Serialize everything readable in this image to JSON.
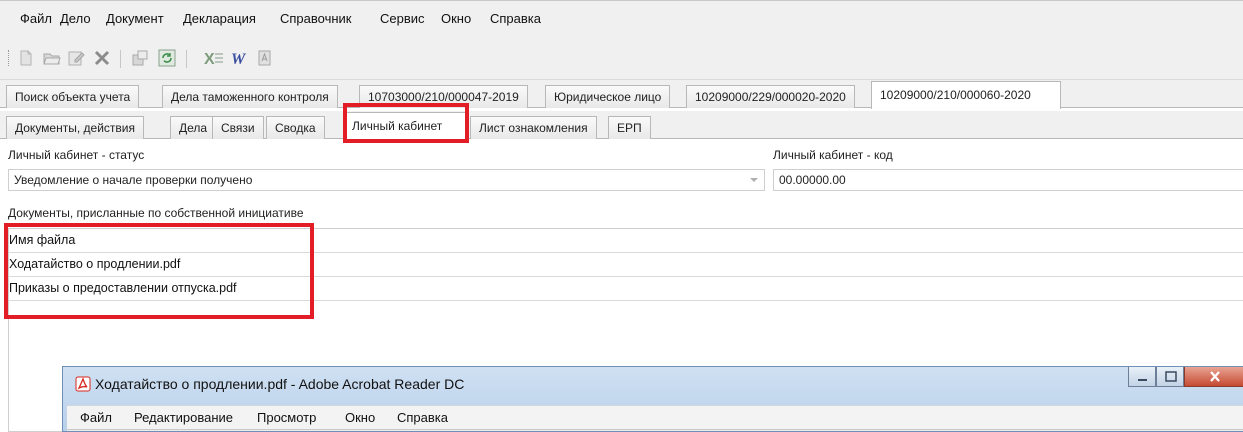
{
  "menu": [
    "Файл",
    "Дело",
    "Документ",
    "Декларация",
    "Справочник",
    "Сервис",
    "Окно",
    "Справка"
  ],
  "tabs_top": [
    "Поиск объекта учета",
    "Дела таможенного контроля",
    "10703000/210/000047-2019",
    "Юридическое лицо",
    "10209000/229/000020-2020",
    "10209000/210/000060-2020"
  ],
  "tabs_sub": [
    "Документы, действия",
    "Дела",
    "Связи",
    "Сводка",
    "Личный кабинет",
    "Лист ознакомления",
    "ЕРП"
  ],
  "status": {
    "label": "Личный кабинет - статус",
    "value": "Уведомление о начале проверки получено"
  },
  "code": {
    "label": "Личный кабинет - код",
    "value": "00.00000.00"
  },
  "documents": {
    "label": "Документы, присланные по собственной инициативе",
    "header": "Имя файла",
    "rows": [
      "Ходатайство о продлении.pdf",
      "Приказы о предоставлении отпуска.pdf"
    ]
  },
  "acrobat": {
    "title": "Ходатайство о продлении.pdf - Adobe Acrobat Reader DC",
    "menu": [
      "Файл",
      "Редактирование",
      "Просмотр",
      "Окно",
      "Справка"
    ]
  },
  "colors": {
    "highlight": "#e21d25",
    "acrobat_red": "#d7281e"
  }
}
